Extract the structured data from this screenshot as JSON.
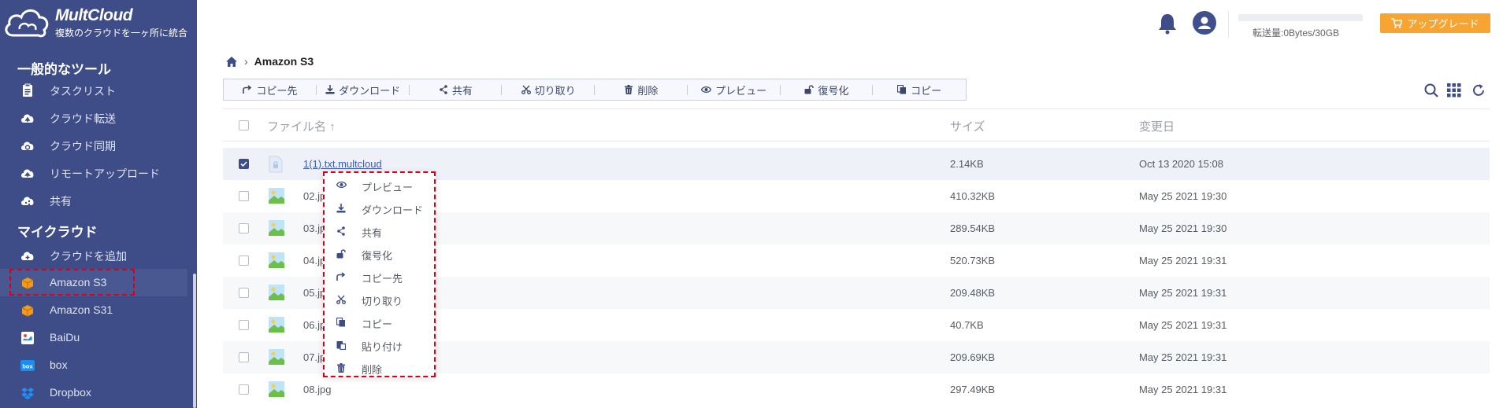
{
  "app": {
    "title": "MultCloud",
    "subtitle": "複数のクラウドを一ヶ所に統合"
  },
  "sidebar": {
    "tools_title": "一般的なツール",
    "tools": [
      {
        "label": "タスクリスト",
        "icon": "task-list-icon"
      },
      {
        "label": "クラウド転送",
        "icon": "cloud-transfer-icon"
      },
      {
        "label": "クラウド同期",
        "icon": "cloud-sync-icon"
      },
      {
        "label": "リモートアップロード",
        "icon": "remote-upload-icon"
      },
      {
        "label": "共有",
        "icon": "share-cloud-icon"
      }
    ],
    "clouds_title": "マイクラウド",
    "add_cloud": "クラウドを追加",
    "clouds": [
      {
        "label": "Amazon S3",
        "icon": "amazon-s3-icon",
        "active": true
      },
      {
        "label": "Amazon S31",
        "icon": "amazon-s3-icon"
      },
      {
        "label": "BaiDu",
        "icon": "baidu-icon"
      },
      {
        "label": "box",
        "icon": "box-icon"
      },
      {
        "label": "Dropbox",
        "icon": "dropbox-icon"
      }
    ]
  },
  "header": {
    "quota_text": "転送量:0Bytes/30GB",
    "upgrade_label": "アップグレード"
  },
  "breadcrumb": {
    "current": "Amazon S3"
  },
  "toolbar": {
    "buttons": [
      "コピー先",
      "ダウンロード",
      "共有",
      "切り取り",
      "削除",
      "プレビュー",
      "復号化",
      "コピー"
    ]
  },
  "table": {
    "headers": {
      "name": "ファイル名",
      "size": "サイズ",
      "modified": "変更日"
    },
    "rows": [
      {
        "name": "1(1).txt.multcloud",
        "size": "2.14KB",
        "date": "Oct 13 2020 15:08",
        "checked": true,
        "type": "file"
      },
      {
        "name": "02.jpg",
        "size": "410.32KB",
        "date": "May 25 2021 19:30",
        "checked": false,
        "type": "image"
      },
      {
        "name": "03.jpg",
        "size": "289.54KB",
        "date": "May 25 2021 19:30",
        "checked": false,
        "type": "image"
      },
      {
        "name": "04.jpg",
        "size": "520.73KB",
        "date": "May 25 2021 19:31",
        "checked": false,
        "type": "image"
      },
      {
        "name": "05.jpg",
        "size": "209.48KB",
        "date": "May 25 2021 19:31",
        "checked": false,
        "type": "image"
      },
      {
        "name": "06.jpg",
        "size": "40.7KB",
        "date": "May 25 2021 19:31",
        "checked": false,
        "type": "image"
      },
      {
        "name": "07.jpg",
        "size": "209.69KB",
        "date": "May 25 2021 19:31",
        "checked": false,
        "type": "image"
      },
      {
        "name": "08.jpg",
        "size": "297.49KB",
        "date": "May 25 2021 19:31",
        "checked": false,
        "type": "image"
      }
    ]
  },
  "context_menu": {
    "items": [
      "プレビュー",
      "ダウンロード",
      "共有",
      "復号化",
      "コピー先",
      "切り取り",
      "コピー",
      "貼り付け",
      "削除"
    ]
  },
  "colors": {
    "sidebar": "#3e4c87",
    "accent": "#f6a532",
    "highlight": "#d9001b",
    "link": "#3c5cc5"
  }
}
